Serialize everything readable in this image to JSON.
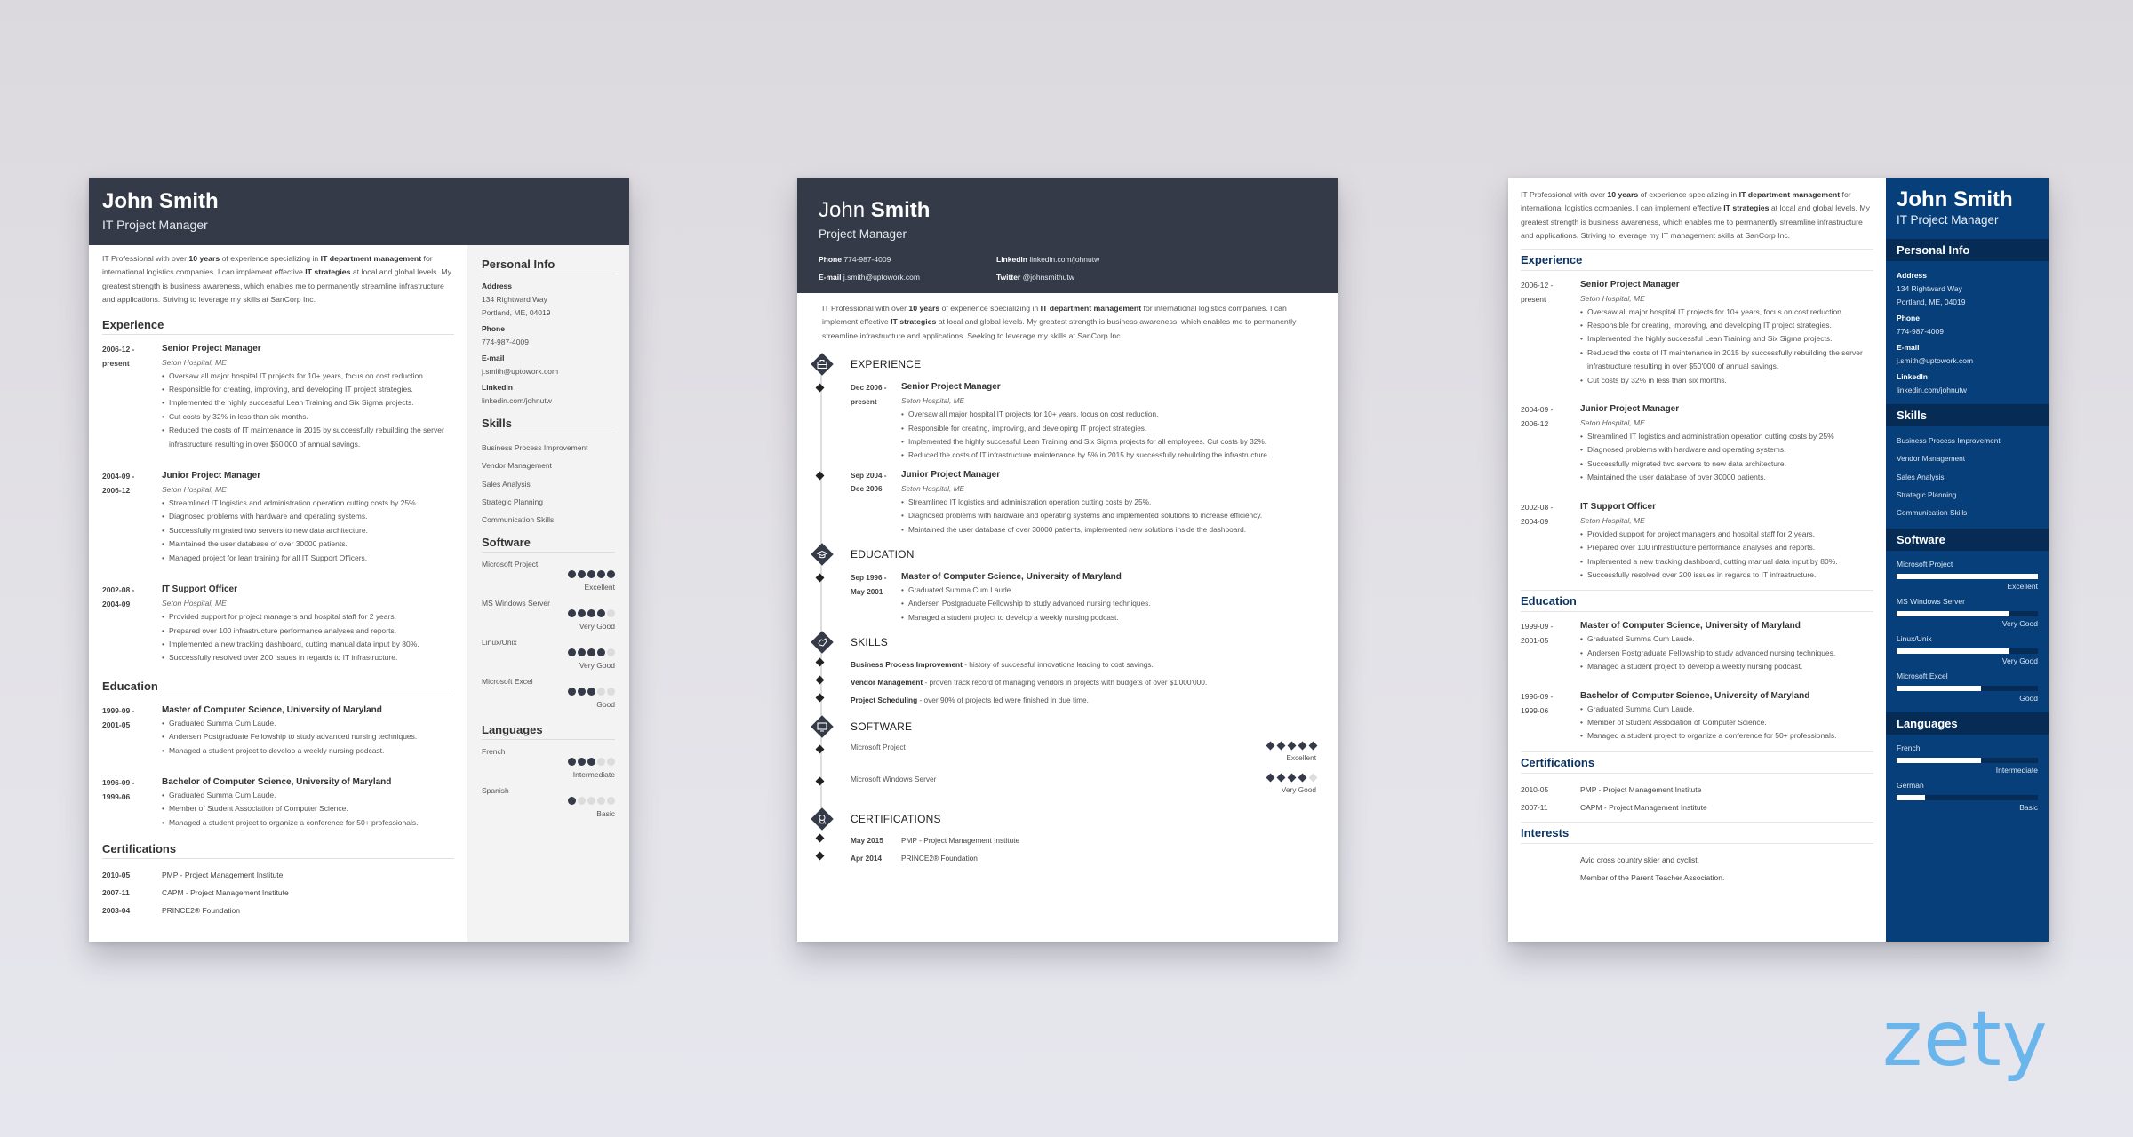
{
  "logo": "zety",
  "colors": {
    "dark_header": "#343a48",
    "blue_sidebar": "#073f7a",
    "logo_blue": "#6ab6ec"
  },
  "resume1": {
    "name": "John Smith",
    "title": "IT Project Manager",
    "summary": {
      "p1": "IT Professional with over ",
      "b1": "10 years",
      "p2": " of experience specializing in ",
      "b2": "IT department management",
      "p3": " for international logistics companies. I can implement effective ",
      "b3": "IT strategies",
      "p4": " at local and global levels. My greatest strength is business awareness, which enables me to permanently streamline infrastructure and applications. Striving to leverage my skills at SanCorp Inc."
    },
    "headings": {
      "experience": "Experience",
      "education": "Education",
      "certifications": "Certifications",
      "personal": "Personal Info",
      "skills": "Skills",
      "software": "Software",
      "languages": "Languages"
    },
    "experience": [
      {
        "date1": "2006-12 -",
        "date2": "present",
        "title": "Senior Project Manager",
        "org": "Seton Hospital, ME",
        "bullets": [
          "Oversaw all major hospital IT projects for 10+ years, focus on cost reduction.",
          "Responsible for creating, improving, and developing IT project strategies.",
          "Implemented the highly successful Lean Training and Six Sigma projects.",
          "Cut costs by 32% in less than six months.",
          "Reduced the costs of IT maintenance in 2015 by successfully rebuilding the server infrastructure resulting in over $50'000 of annual savings."
        ]
      },
      {
        "date1": "2004-09 -",
        "date2": "2006-12",
        "title": "Junior Project Manager",
        "org": "Seton Hospital, ME",
        "bullets": [
          "Streamlined IT logistics and administration operation cutting costs by 25%",
          "Diagnosed problems with hardware and operating systems.",
          "Successfully migrated two servers to new data architecture.",
          "Maintained the user database of over 30000 patients.",
          "Managed project for lean training for all IT Support Officers."
        ]
      },
      {
        "date1": "2002-08 -",
        "date2": "2004-09",
        "title": "IT Support Officer",
        "org": "Seton Hospital, ME",
        "bullets": [
          "Provided support for project managers and hospital staff for 2 years.",
          "Prepared over 100 infrastructure performance analyses and reports.",
          "Implemented a new tracking dashboard, cutting manual data input by 80%.",
          "Successfully resolved over 200 issues in regards to IT infrastructure."
        ]
      }
    ],
    "education": [
      {
        "date1": "1999-09 -",
        "date2": "2001-05",
        "title": "Master of Computer Science, University of Maryland",
        "bullets": [
          "Graduated Summa Cum Laude.",
          "Andersen Postgraduate Fellowship to study advanced nursing techniques.",
          "Managed a student project to develop a weekly nursing podcast."
        ]
      },
      {
        "date1": "1996-09 -",
        "date2": "1999-06",
        "title": "Bachelor of Computer Science, University of Maryland",
        "bullets": [
          "Graduated Summa Cum Laude.",
          "Member of Student Association of Computer Science.",
          "Managed a student project to organize a conference for 50+ professionals."
        ]
      }
    ],
    "certifications": [
      {
        "date": "2010-05",
        "name": "PMP - Project Management Institute"
      },
      {
        "date": "2007-11",
        "name": "CAPM - Project Management Institute"
      },
      {
        "date": "2003-04",
        "name": "PRINCE2® Foundation"
      }
    ],
    "personal": [
      {
        "label": "Address",
        "lines": [
          "134 Rightward Way",
          "Portland, ME, 04019"
        ]
      },
      {
        "label": "Phone",
        "lines": [
          "774-987-4009"
        ]
      },
      {
        "label": "E-mail",
        "lines": [
          "j.smith@uptowork.com"
        ]
      },
      {
        "label": "LinkedIn",
        "lines": [
          "linkedin.com/johnutw"
        ]
      }
    ],
    "skills": [
      "Business Process Improvement",
      "Vendor Management",
      "Sales Analysis",
      "Strategic Planning",
      "Communication Skills"
    ],
    "software": [
      {
        "name": "Microsoft Project",
        "rating": 5,
        "max": 5,
        "label": "Excellent"
      },
      {
        "name": "MS Windows Server",
        "rating": 4,
        "max": 5,
        "label": "Very Good"
      },
      {
        "name": "Linux/Unix",
        "rating": 4,
        "max": 5,
        "label": "Very Good"
      },
      {
        "name": "Microsoft Excel",
        "rating": 3,
        "max": 5,
        "label": "Good"
      }
    ],
    "languages": [
      {
        "name": "French",
        "rating": 3,
        "max": 5,
        "label": "Intermediate"
      },
      {
        "name": "Spanish",
        "rating": 1,
        "max": 5,
        "label": "Basic"
      }
    ]
  },
  "resume2": {
    "first_name": "John",
    "last_name": "Smith",
    "title": "Project Manager",
    "contacts": [
      {
        "label": "Phone",
        "value": "774-987-4009"
      },
      {
        "label": "LinkedIn",
        "value": "linkedin.com/johnutw"
      },
      {
        "label": "E-mail",
        "value": "j.smith@uptowork.com"
      },
      {
        "label": "Twitter",
        "value": "@johnsmithutw"
      }
    ],
    "summary": {
      "p1": "IT Professional with over ",
      "b1": "10 years",
      "p2": " of experience specializing in ",
      "b2": "IT department management",
      "p3": " for international logistics companies. I can implement effective ",
      "b3": "IT strategies",
      "p4": " at local and global levels. My greatest strength is business awareness, which enables me to permanently streamline infrastructure and applications. Seeking to leverage my skills at SanCorp Inc."
    },
    "headings": {
      "experience": "EXPERIENCE",
      "education": "EDUCATION",
      "skills": "SKILLS",
      "software": "SOFTWARE",
      "certifications": "CERTIFICATIONS"
    },
    "experience": [
      {
        "date1": "Dec 2006 -",
        "date2": "present",
        "title": "Senior Project Manager",
        "org": "Seton Hospital, ME",
        "bullets": [
          "Oversaw all major hospital IT projects for 10+ years, focus on cost reduction.",
          "Responsible for creating, improving, and developing IT project strategies.",
          "Implemented the highly successful Lean Training and Six Sigma projects for all employees. Cut costs by 32%.",
          "Reduced the costs of IT infrastructure maintenance by 5% in 2015 by successfully rebuilding the infrastructure."
        ]
      },
      {
        "date1": "Sep 2004 -",
        "date2": "Dec 2006",
        "title": "Junior Project Manager",
        "org": "Seton Hospital, ME",
        "bullets": [
          "Streamlined IT logistics and administration operation cutting costs by 25%.",
          "Diagnosed problems with hardware and operating systems and implemented solutions to increase efficiency.",
          "Maintained the user database of over 30000 patients, implemented new solutions inside the dashboard."
        ]
      }
    ],
    "education": [
      {
        "date1": "Sep 1996 -",
        "date2": "May 2001",
        "title": "Master of Computer Science, University of Maryland",
        "bullets": [
          "Graduated Summa Cum Laude.",
          "Andersen Postgraduate Fellowship to study advanced nursing techniques.",
          "Managed a student project to develop a weekly nursing podcast."
        ]
      }
    ],
    "skills": [
      {
        "name": "Business Process Improvement",
        "desc": " - history of successful innovations leading to cost savings."
      },
      {
        "name": "Vendor Management",
        "desc": " - proven track record of managing vendors in projects with budgets of over $1'000'000."
      },
      {
        "name": "Project Scheduling",
        "desc": " - over 90% of projects led were finished in due time."
      }
    ],
    "software": [
      {
        "name": "Microsoft Project",
        "rating": 5,
        "max": 5,
        "label": "Excellent"
      },
      {
        "name": "Microsoft Windows Server",
        "rating": 4,
        "max": 5,
        "label": "Very Good"
      }
    ],
    "certifications": [
      {
        "date": "May 2015",
        "name": "PMP - Project Management Institute"
      },
      {
        "date": "Apr 2014",
        "name": "PRINCE2® Foundation"
      }
    ]
  },
  "resume3": {
    "name": "John Smith",
    "title": "IT Project Manager",
    "summary": {
      "p1": "IT Professional with over ",
      "b1": "10 years",
      "p2": " of experience specializing in ",
      "b2": "IT department management",
      "p3": " for international logistics companies. I can implement effective ",
      "b3": "IT strategies",
      "p4": " at local and global levels. My greatest strength is business awareness, which enables me to permanently streamline infrastructure and applications. Striving to leverage my IT management skills at SanCorp Inc."
    },
    "headings": {
      "experience": "Experience",
      "education": "Education",
      "certifications": "Certifications",
      "interests": "Interests",
      "personal": "Personal Info",
      "skills": "Skills",
      "software": "Software",
      "languages": "Languages"
    },
    "experience": [
      {
        "date1": "2006-12 -",
        "date2": "present",
        "title": "Senior Project Manager",
        "org": "Seton Hospital, ME",
        "bullets": [
          "Oversaw all major hospital IT projects for 10+ years, focus on cost reduction.",
          "Responsible for creating, improving, and developing IT project strategies.",
          "Implemented the highly successful Lean Training and Six Sigma projects.",
          "Reduced the costs of IT maintenance in 2015 by successfully rebuilding the server infrastructure resulting in over $50'000 of annual savings.",
          "Cut costs by 32% in less than six months."
        ]
      },
      {
        "date1": "2004-09 -",
        "date2": "2006-12",
        "title": "Junior Project Manager",
        "org": "Seton Hospital, ME",
        "bullets": [
          "Streamlined IT logistics and administration operation cutting costs by 25%",
          "Diagnosed problems with hardware and operating systems.",
          "Successfully migrated two servers to new data architecture.",
          "Maintained the user database of over 30000 patients."
        ]
      },
      {
        "date1": "2002-08 -",
        "date2": "2004-09",
        "title": "IT Support Officer",
        "org": "Seton Hospital, ME",
        "bullets": [
          "Provided support for project managers and hospital staff for 2 years.",
          "Prepared over 100 infrastructure performance analyses and reports.",
          "Implemented a new tracking dashboard, cutting manual data input by 80%.",
          "Successfully resolved over 200 issues in regards to IT infrastructure."
        ]
      }
    ],
    "education": [
      {
        "date1": "1999-09 -",
        "date2": "2001-05",
        "title": "Master of Computer Science, University of Maryland",
        "bullets": [
          "Graduated Summa Cum Laude.",
          "Andersen Postgraduate Fellowship to study advanced nursing techniques.",
          "Managed a student project to develop a weekly nursing podcast."
        ]
      },
      {
        "date1": "1996-09 -",
        "date2": "1999-06",
        "title": "Bachelor of Computer Science, University of Maryland",
        "bullets": [
          "Graduated Summa Cum Laude.",
          "Member of Student Association of Computer Science.",
          "Managed a student project to organize a conference for 50+ professionals."
        ]
      }
    ],
    "certifications": [
      {
        "date": "2010-05",
        "name": "PMP - Project Management Institute"
      },
      {
        "date": "2007-11",
        "name": "CAPM - Project Management Institute"
      }
    ],
    "interests": [
      "Avid cross country skier and cyclist.",
      "Member of the Parent Teacher Association."
    ],
    "personal": [
      {
        "label": "Address",
        "lines": [
          "134 Rightward Way",
          "Portland, ME, 04019"
        ]
      },
      {
        "label": "Phone",
        "lines": [
          "774-987-4009"
        ]
      },
      {
        "label": "E-mail",
        "lines": [
          "j.smith@uptowork.com"
        ]
      },
      {
        "label": "LinkedIn",
        "lines": [
          "linkedin.com/johnutw"
        ]
      }
    ],
    "skills": [
      "Business Process Improvement",
      "Vendor Management",
      "Sales Analysis",
      "Strategic Planning",
      "Communication Skills"
    ],
    "software": [
      {
        "name": "Microsoft Project",
        "level": 1.0,
        "label": "Excellent"
      },
      {
        "name": "MS Windows Server",
        "level": 0.8,
        "label": "Very Good"
      },
      {
        "name": "Linux/Unix",
        "level": 0.8,
        "label": "Very Good"
      },
      {
        "name": "Microsoft Excel",
        "level": 0.6,
        "label": "Good"
      }
    ],
    "languages": [
      {
        "name": "French",
        "level": 0.6,
        "label": "Intermediate"
      },
      {
        "name": "German",
        "level": 0.2,
        "label": "Basic"
      }
    ]
  }
}
